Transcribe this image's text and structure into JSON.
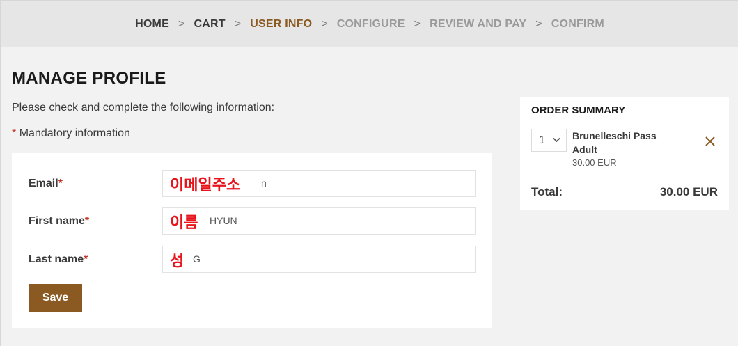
{
  "breadcrumb": {
    "steps": [
      {
        "label": "HOME",
        "state": "done"
      },
      {
        "label": "CART",
        "state": "done"
      },
      {
        "label": "USER INFO",
        "state": "active"
      },
      {
        "label": "CONFIGURE",
        "state": "pending"
      },
      {
        "label": "REVIEW AND PAY",
        "state": "pending"
      },
      {
        "label": "CONFIRM",
        "state": "pending"
      }
    ],
    "separator": ">"
  },
  "page": {
    "title": "MANAGE PROFILE",
    "intro": "Please check and complete the following information:",
    "mandatory_star": "*",
    "mandatory_text": "Mandatory information"
  },
  "form": {
    "fields": [
      {
        "label": "Email",
        "required_mark": "*",
        "overlay": "이메일주소",
        "visible_tail": "n"
      },
      {
        "label": "First name",
        "required_mark": "*",
        "overlay": "이름",
        "visible_tail": "HYUN"
      },
      {
        "label": "Last name",
        "required_mark": "*",
        "overlay": "성",
        "visible_tail": "G"
      }
    ],
    "save_label": "Save"
  },
  "summary": {
    "title": "ORDER SUMMARY",
    "item": {
      "quantity": "1",
      "name_line1": "Brunelleschi Pass",
      "name_line2": "Adult",
      "price": "30.00 EUR"
    },
    "total_label": "Total:",
    "total_value": "30.00 EUR"
  },
  "colors": {
    "accent": "#8b5a22",
    "required": "#c0392b",
    "overlay_text": "#e8141c",
    "header_bg": "#e6e6e6",
    "page_bg": "#f2f2f2"
  },
  "icons": {
    "quantity_dropdown": "chevron-down-icon",
    "remove_item": "close-icon"
  }
}
